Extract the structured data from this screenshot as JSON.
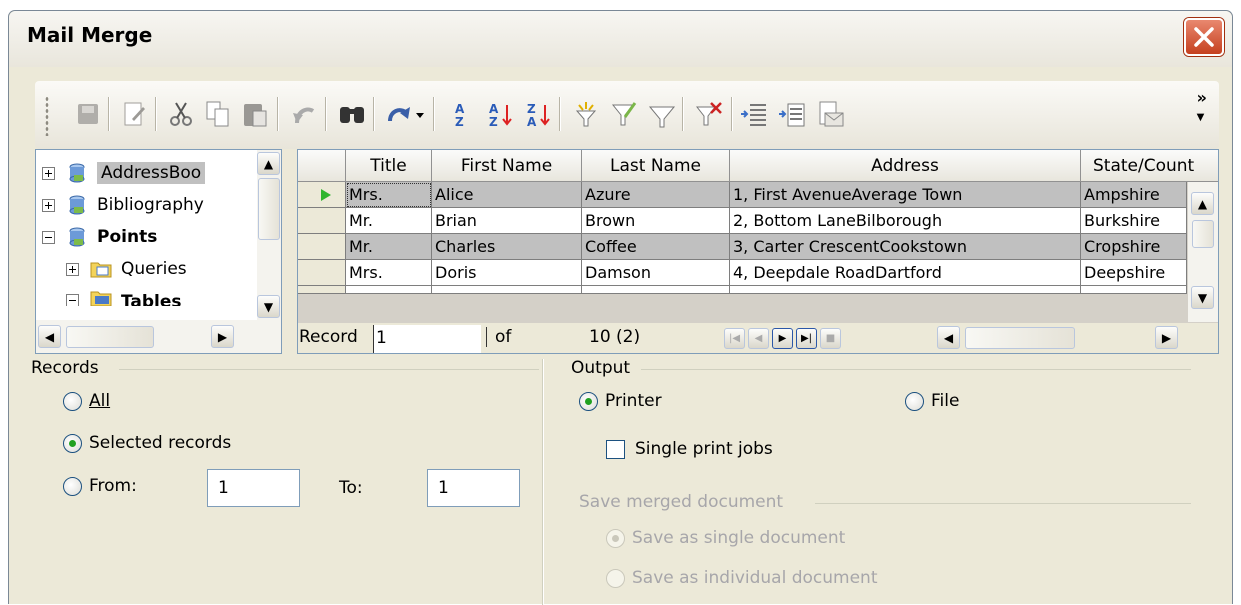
{
  "window": {
    "title": "Mail Merge"
  },
  "toolbar": {
    "buttons": [
      "save-icon",
      "edit-icon",
      "cut-icon",
      "copy-icon",
      "paste-icon",
      "undo-icon",
      "find-icon",
      "redo-icon",
      "sort-icon",
      "sort-ascending-icon",
      "sort-descending-icon",
      "autofilter-icon",
      "standard-filter-icon",
      "filter-icon",
      "remove-filter-icon",
      "data-to-text-icon",
      "data-to-fields-icon",
      "mail-merge-icon"
    ],
    "more": "»"
  },
  "tree": {
    "items": [
      {
        "label": "AddressBoo",
        "expander": "plus"
      },
      {
        "label": "Bibliography",
        "expander": "plus"
      },
      {
        "label": "Points",
        "expander": "minus"
      },
      {
        "label": "Queries",
        "expander": "plus"
      },
      {
        "label": "Tables",
        "expander": "minus"
      }
    ]
  },
  "grid": {
    "columns": [
      "Title",
      "First Name",
      "Last Name",
      "Address",
      "State/Count"
    ],
    "rows": [
      [
        "Mrs.",
        "Alice",
        "Azure",
        "1, First AvenueAverage Town",
        "Ampshire"
      ],
      [
        "Mr.",
        "Brian",
        "Brown",
        "2, Bottom LaneBilborough",
        "Burkshire"
      ],
      [
        "Mr.",
        "Charles",
        "Coffee",
        "3, Carter CrescentCookstown",
        "Cropshire"
      ],
      [
        "Mrs.",
        "Doris",
        "Damson",
        "4, Deepdale RoadDartford",
        "Deepshire"
      ]
    ],
    "nav": {
      "record_label": "Record",
      "record_value": "1",
      "of_label": "of",
      "count": "10 (2)"
    }
  },
  "records": {
    "label": "Records",
    "all": "All",
    "selected": "Selected records",
    "from": "From:",
    "from_value": "1",
    "to": "To:",
    "to_value": "1",
    "selected_option": "selected"
  },
  "output": {
    "label": "Output",
    "printer": "Printer",
    "file": "File",
    "single_print_jobs": "Single print jobs",
    "save_merged_label": "Save merged document",
    "save_single": "Save as single document",
    "save_individual": "Save as individual document"
  }
}
